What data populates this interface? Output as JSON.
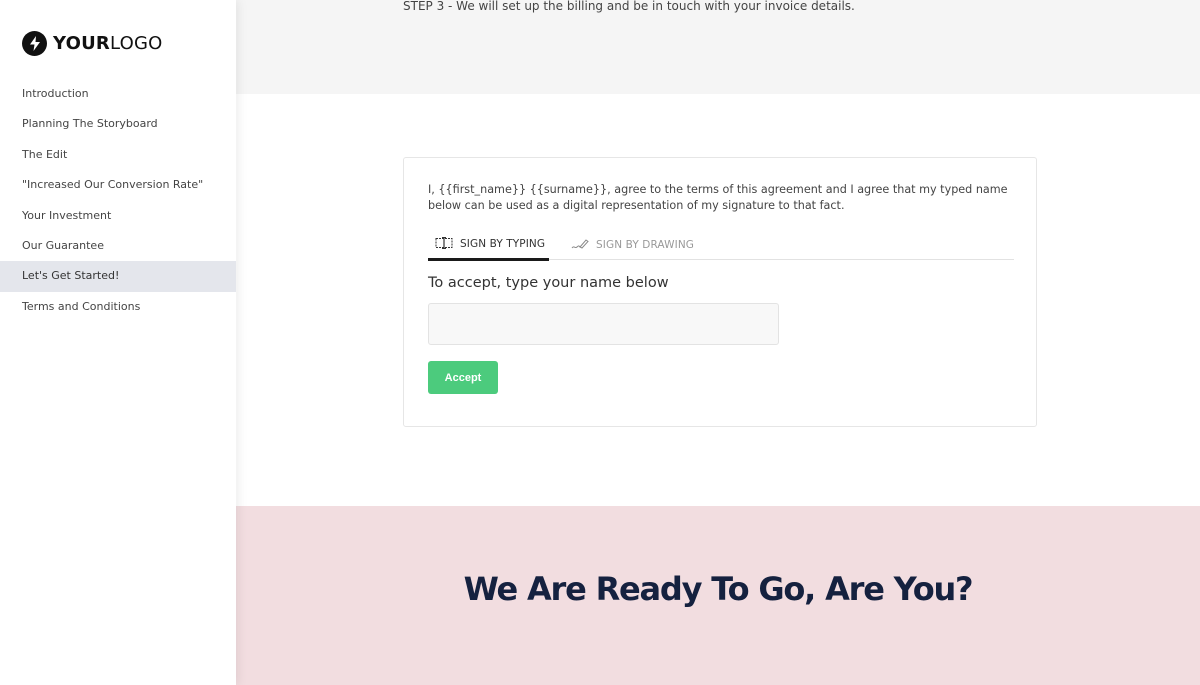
{
  "sidebar": {
    "logo": {
      "icon": "lightning-bolt-icon",
      "text_bold": "YOUR",
      "text_light": "LOGO"
    },
    "items": [
      {
        "label": "Introduction",
        "active": false
      },
      {
        "label": "Planning The Storyboard",
        "active": false
      },
      {
        "label": "The Edit",
        "active": false
      },
      {
        "label": "\"Increased Our Conversion Rate\"",
        "active": false
      },
      {
        "label": "Your Investment",
        "active": false
      },
      {
        "label": "Our Guarantee",
        "active": false
      },
      {
        "label": "Let's Get Started!",
        "active": true
      },
      {
        "label": "Terms and Conditions",
        "active": false
      }
    ]
  },
  "main": {
    "step_text": "STEP 3 - We will set up the billing and be in touch with your invoice details.",
    "signature": {
      "agreement_text": "I, {{first_name}} {{surname}}, agree to the terms of this agreement and I agree that my typed name below can be used as a digital representation of my signature to that fact.",
      "tabs": [
        {
          "label": "SIGN BY TYPING",
          "icon": "keyboard-cursor-icon",
          "active": true
        },
        {
          "label": "SIGN BY DRAWING",
          "icon": "pen-signature-icon",
          "active": false
        }
      ],
      "accept_label": "To accept, type your name below",
      "name_input": {
        "value": "",
        "placeholder": ""
      },
      "accept_button": "Accept"
    },
    "cta": {
      "title": "We Are Ready To Go, Are You?"
    }
  },
  "colors": {
    "accent_green": "#4ccb7d",
    "cta_background": "#f2dde0",
    "cta_text": "#15213f",
    "active_nav": "#e4e6ec"
  }
}
